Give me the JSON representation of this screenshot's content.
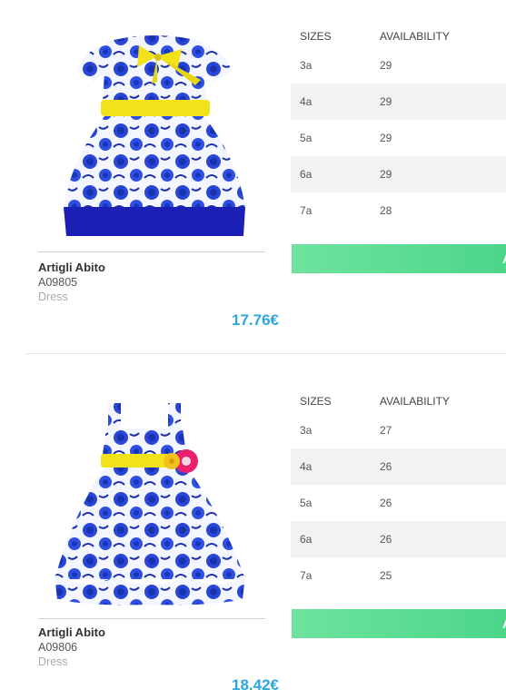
{
  "table_headers": {
    "sizes": "SIZES",
    "availability": "AVAILABILITY"
  },
  "products": [
    {
      "name": "Artigli Abito",
      "code": "A09805",
      "category": "Dress",
      "price": "17.76€",
      "sizes": [
        {
          "size": "3a",
          "availability": "29"
        },
        {
          "size": "4a",
          "availability": "29"
        },
        {
          "size": "5a",
          "availability": "29"
        },
        {
          "size": "6a",
          "availability": "29"
        },
        {
          "size": "7a",
          "availability": "28"
        }
      ],
      "button_label": "A"
    },
    {
      "name": "Artigli Abito",
      "code": "A09806",
      "category": "Dress",
      "price": "18.42€",
      "sizes": [
        {
          "size": "3a",
          "availability": "27"
        },
        {
          "size": "4a",
          "availability": "26"
        },
        {
          "size": "5a",
          "availability": "26"
        },
        {
          "size": "6a",
          "availability": "26"
        },
        {
          "size": "7a",
          "availability": "25"
        }
      ],
      "button_label": "A"
    }
  ],
  "colors": {
    "price": "#2aa7e0",
    "button": "#5cdb95",
    "row_stripe": "#f2f2f2"
  }
}
